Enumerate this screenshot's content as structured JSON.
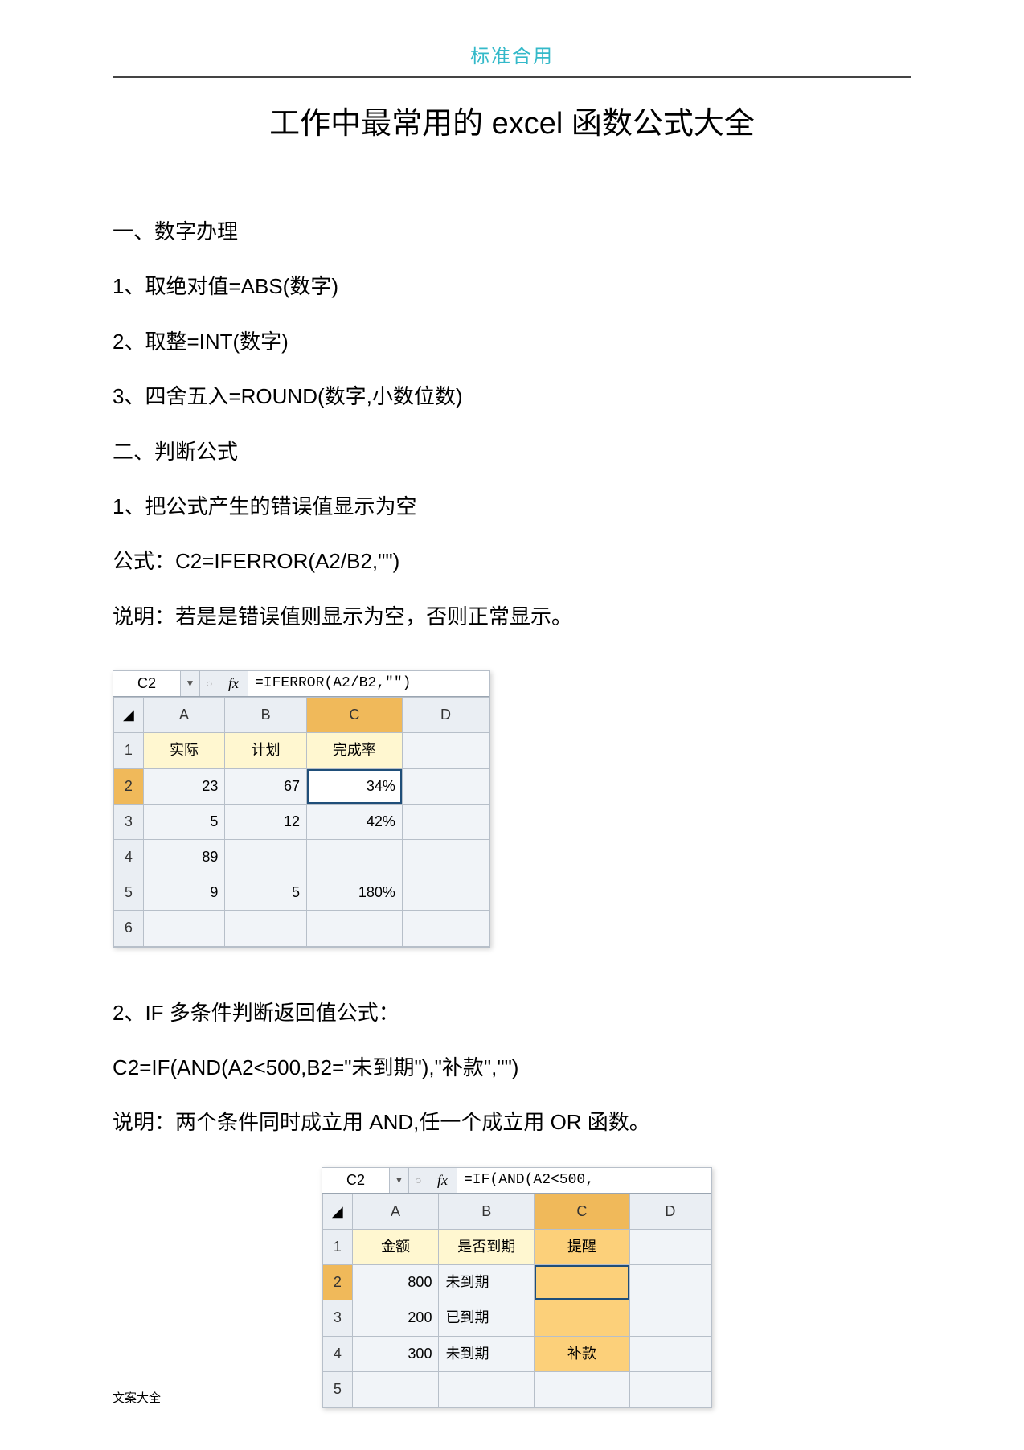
{
  "page_header": "标准合用",
  "title": "工作中最常用的 excel 函数公式大全",
  "section1_heading": "一、数字办理",
  "s1_item1": "1、取绝对值=ABS(数字)",
  "s1_item2": "2、取整=INT(数字)",
  "s1_item3": "3、四舍五入=ROUND(数字,小数位数)",
  "section2_heading": "二、判断公式",
  "s2_item1": "1、把公式产生的错误值显示为空",
  "s2_formula_label": "公式：C2=IFERROR(A2/B2,\"\")",
  "s2_explain": "说明：若是是错误值则显示为空，否则正常显示。",
  "excel1": {
    "name_box": "C2",
    "fx_label": "fx",
    "formula": "=IFERROR(A2/B2,\"\")",
    "cols": [
      "A",
      "B",
      "C",
      "D"
    ],
    "rows": [
      "1",
      "2",
      "3",
      "4",
      "5",
      "6"
    ],
    "header_row": [
      "实际",
      "计划",
      "完成率",
      ""
    ],
    "data": [
      [
        "23",
        "67",
        "34%",
        ""
      ],
      [
        "5",
        "12",
        "42%",
        ""
      ],
      [
        "89",
        "",
        "",
        ""
      ],
      [
        "9",
        "5",
        "180%",
        ""
      ],
      [
        "",
        "",
        "",
        ""
      ]
    ]
  },
  "s2_item2": "2、IF 多条件判断返回值公式：",
  "s2_formula2": "C2=IF(AND(A2<500,B2=\"未到期\"),\"补款\",\"\")",
  "s2_explain2": "说明：两个条件同时成立用 AND,任一个成立用 OR 函数。",
  "excel2": {
    "name_box": "C2",
    "fx_label": "fx",
    "formula": "=IF(AND(A2<500,",
    "cols": [
      "A",
      "B",
      "C",
      "D"
    ],
    "rows": [
      "1",
      "2",
      "3",
      "4",
      "5"
    ],
    "header_row": [
      "金额",
      "是否到期",
      "提醒",
      ""
    ],
    "data": [
      [
        "800",
        "未到期",
        "",
        ""
      ],
      [
        "200",
        "已到期",
        "",
        ""
      ],
      [
        "300",
        "未到期",
        "补款",
        ""
      ],
      [
        "",
        "",
        "",
        ""
      ]
    ]
  },
  "footer": "文案大全"
}
